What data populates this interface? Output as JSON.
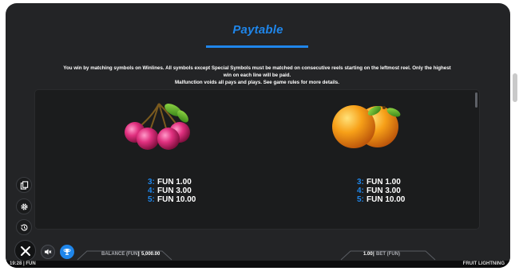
{
  "header": {
    "title": "Paytable",
    "intro_line1": "You win by matching symbols on Winlines. All symbols except Special Symbols must be matched on consecutive reels starting on the leftmost reel. Only the highest win on each line will be paid.",
    "intro_line2": "Malfunction voids all pays and plays. See game rules for more details."
  },
  "symbols": [
    {
      "icon": "cherries-icon",
      "pays": [
        {
          "count": "3:",
          "value": "FUN 1.00"
        },
        {
          "count": "4:",
          "value": "FUN 3.00"
        },
        {
          "count": "5:",
          "value": "FUN 10.00"
        }
      ]
    },
    {
      "icon": "oranges-icon",
      "pays": [
        {
          "count": "3:",
          "value": "FUN 1.00"
        },
        {
          "count": "4:",
          "value": "FUN 3.00"
        },
        {
          "count": "5:",
          "value": "FUN 10.00"
        }
      ]
    }
  ],
  "side_buttons": [
    "paytable-icon",
    "settings-icon",
    "history-icon"
  ],
  "controls": {
    "close": "close-icon",
    "sound": "sound-off-icon",
    "trophy": "trophy-icon"
  },
  "bottom_bar": {
    "balance_label": "BALANCE (FUN)",
    "separator": "|",
    "balance_value": "5,000.00",
    "bet_value": "1.00",
    "bet_label": "BET (FUN)"
  },
  "status_bar": {
    "time_currency": "19:28 | FUN",
    "game_name": "FRUIT LIGHTNING"
  },
  "colors": {
    "accent": "#1f86ea",
    "background": "#232426",
    "panel": "#1b1c1d"
  }
}
